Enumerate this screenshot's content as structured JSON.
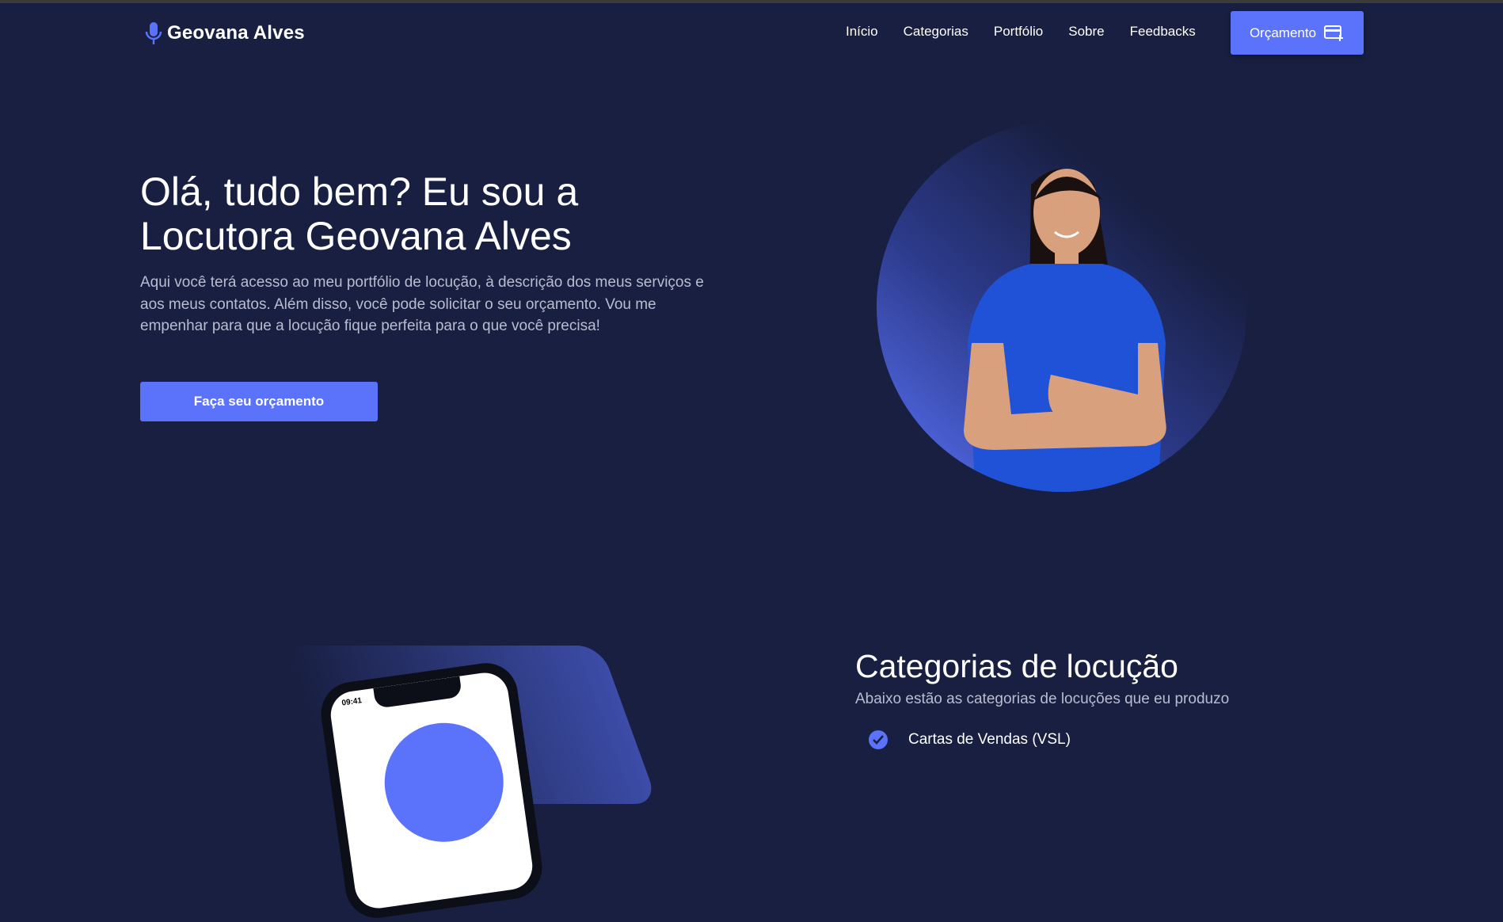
{
  "header": {
    "brand": "Geovana Alves",
    "nav": [
      "Início",
      "Categorias",
      "Portfólio",
      "Sobre",
      "Feedbacks"
    ],
    "cta": "Orçamento"
  },
  "hero": {
    "title": "Olá, tudo bem? Eu sou a Locutora Geovana Alves",
    "text": "Aqui você terá acesso ao meu portfólio de locução, à descrição dos meus serviços e aos meus contatos. Além disso, você pode solicitar o seu orçamento. Vou me empenhar para que a locução fique perfeita para o que você precisa!",
    "button": "Faça seu orçamento"
  },
  "categories": {
    "phone_time": "09:41",
    "title": "Categorias de locução",
    "subtitle": "Abaixo estão as categorias de locuções que eu produzo",
    "items": [
      "Cartas de Vendas (VSL)"
    ]
  },
  "colors": {
    "accent": "#5a73fa",
    "background": "#181f41"
  }
}
